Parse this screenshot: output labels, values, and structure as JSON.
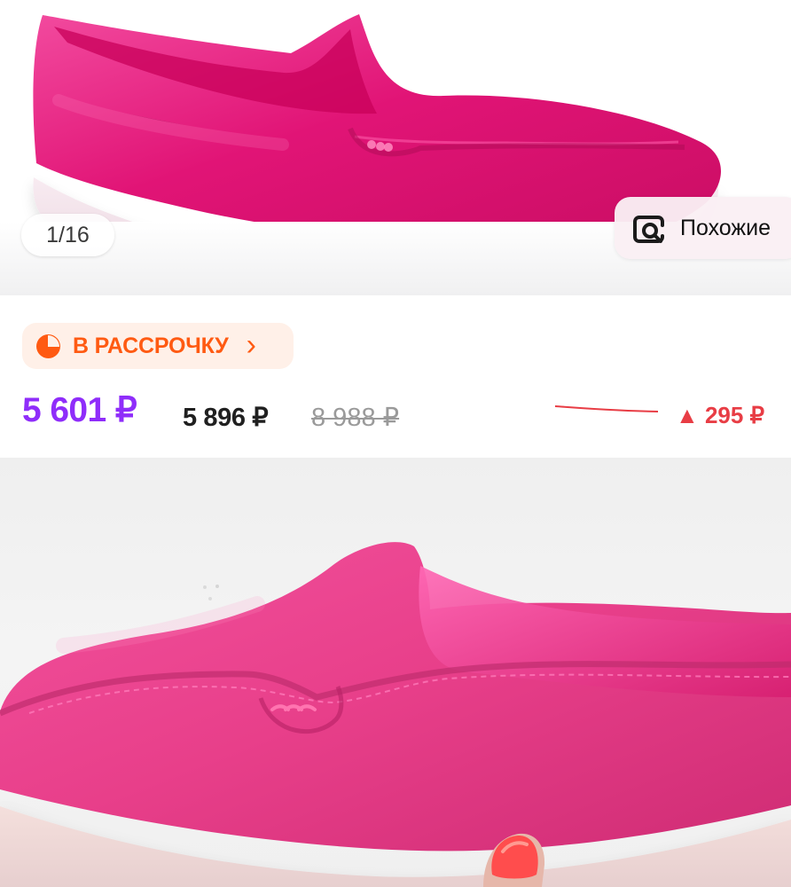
{
  "screen": {
    "top_image": {
      "counter": "1/16",
      "similar_label": "Похожие",
      "similar_icon": "search-image-icon"
    },
    "installment": {
      "label": "В РАССРОЧКУ",
      "icon": "pie-chart-icon",
      "chevron": "›",
      "color": "#ff5a12"
    },
    "prices": {
      "current": "5 601 ₽",
      "secondary": "5 896 ₽",
      "old": "8 988 ₽",
      "change": "▲ 295 ₽",
      "current_color": "#8f2dfa",
      "change_color": "#e83d45"
    },
    "images": {
      "top": "pink-suede-loafer-product-photo",
      "bottom": "pink-suede-loafer-hand-photo"
    }
  }
}
